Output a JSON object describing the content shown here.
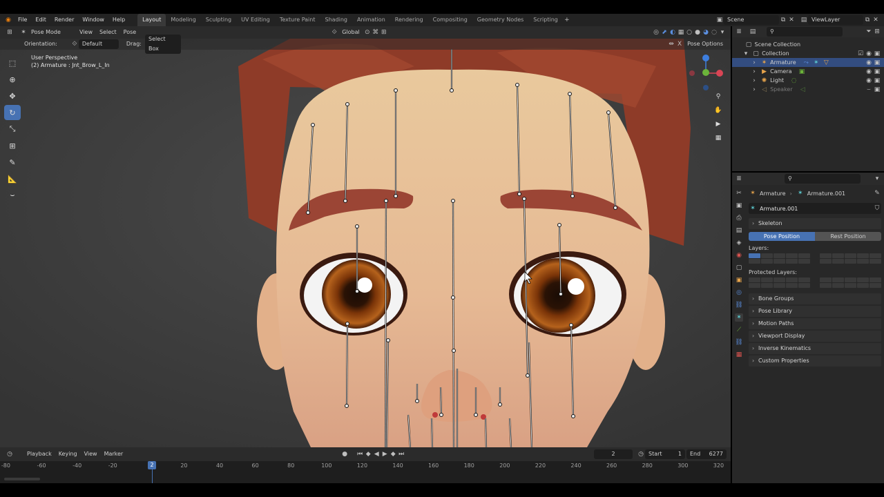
{
  "menubar": {
    "items": [
      "File",
      "Edit",
      "Render",
      "Window",
      "Help"
    ],
    "workspaces": [
      "Layout",
      "Modeling",
      "Sculpting",
      "UV Editing",
      "Texture Paint",
      "Shading",
      "Animation",
      "Rendering",
      "Compositing",
      "Geometry Nodes",
      "Scripting"
    ],
    "active_workspace": "Layout",
    "scene": "Scene",
    "view_layer": "ViewLayer"
  },
  "viewport_header": {
    "mode": "Pose Mode",
    "menus": [
      "View",
      "Select",
      "Pose"
    ],
    "transform_orientation": "Global"
  },
  "tool_header": {
    "orientation_label": "Orientation:",
    "orientation_value": "Default",
    "drag_label": "Drag:",
    "drag_value": "Select Box",
    "pose_options": "Pose Options"
  },
  "viewport": {
    "perspective": "User Perspective",
    "active_object": "(2) Armature : Jnt_Brow_L_In"
  },
  "outliner": {
    "scene_collection": "Scene Collection",
    "collection": "Collection",
    "items": [
      {
        "name": "Armature",
        "selected": true
      },
      {
        "name": "Camera",
        "selected": false
      },
      {
        "name": "Light",
        "selected": false
      },
      {
        "name": "Speaker",
        "selected": false
      }
    ]
  },
  "properties": {
    "breadcrumb_object": "Armature",
    "breadcrumb_data": "Armature.001",
    "data_name": "Armature.001",
    "skeleton_label": "Skeleton",
    "pose_position": "Pose Position",
    "rest_position": "Rest Position",
    "layers_label": "Layers:",
    "protected_layers_label": "Protected Layers:",
    "panels": [
      "Bone Groups",
      "Pose Library",
      "Motion Paths",
      "Viewport Display",
      "Inverse Kinematics",
      "Custom Properties"
    ]
  },
  "timeline": {
    "menus": [
      "Playback",
      "Keying",
      "View",
      "Marker"
    ],
    "current_frame": "2",
    "start_label": "Start",
    "start_value": "1",
    "end_label": "End",
    "end_value": "6277",
    "ticks": [
      "-80",
      "-60",
      "-40",
      "-20",
      "20",
      "40",
      "60",
      "80",
      "100",
      "120",
      "140",
      "160",
      "180",
      "200",
      "220",
      "240",
      "260",
      "280",
      "300",
      "320"
    ],
    "playhead": "2"
  },
  "colors": {
    "accent": "#4772b3",
    "skin": "#e5bf94",
    "hair": "#8a3a2a",
    "iris": "#8a3d10"
  }
}
